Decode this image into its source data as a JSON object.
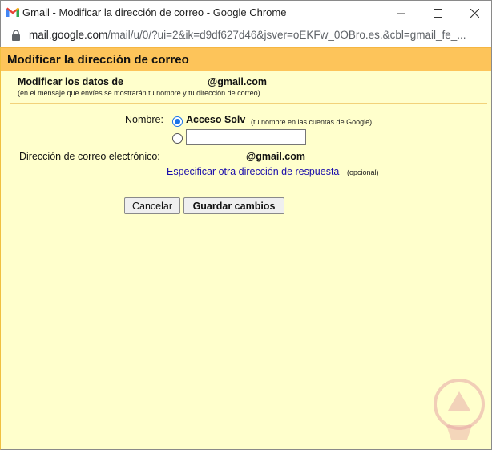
{
  "window": {
    "title": "Gmail - Modificar la dirección de correo - Google Chrome"
  },
  "addressbar": {
    "url_host": "mail.google.com",
    "url_path": "/mail/u/0/?ui=2&ik=d9df627d46&jsver=oEKFw_0OBro.es.&cbl=gmail_fe_..."
  },
  "dialog": {
    "title": "Modificar la dirección de correo",
    "subtitle": "Modificar los datos de",
    "subtitle_email": "@gmail.com",
    "note": "(en el mensaje que envíes se mostrarán tu nombre y tu dirección de correo)",
    "name_label": "Nombre:",
    "name_options": [
      {
        "label": "Acceso Solv",
        "note": "(tu nombre en las cuentas de Google)",
        "checked": true
      },
      {
        "label": "",
        "input_value": "",
        "checked": false
      }
    ],
    "email_label": "Dirección de correo electrónico:",
    "email_value": "@gmail.com",
    "reply_link": "Especificar otra dirección de respuesta",
    "reply_note": "(opcional)",
    "cancel_label": "Cancelar",
    "save_label": "Guardar cambios"
  },
  "colors": {
    "header_band": "#fdc45a",
    "content_bg": "#ffffcc",
    "link": "#1a0dab",
    "radio_accent": "#1a73e8"
  },
  "icons": [
    "gmail-logo-icon",
    "minimize-icon",
    "maximize-icon",
    "close-icon",
    "lock-icon",
    "watermark-logo-icon"
  ]
}
